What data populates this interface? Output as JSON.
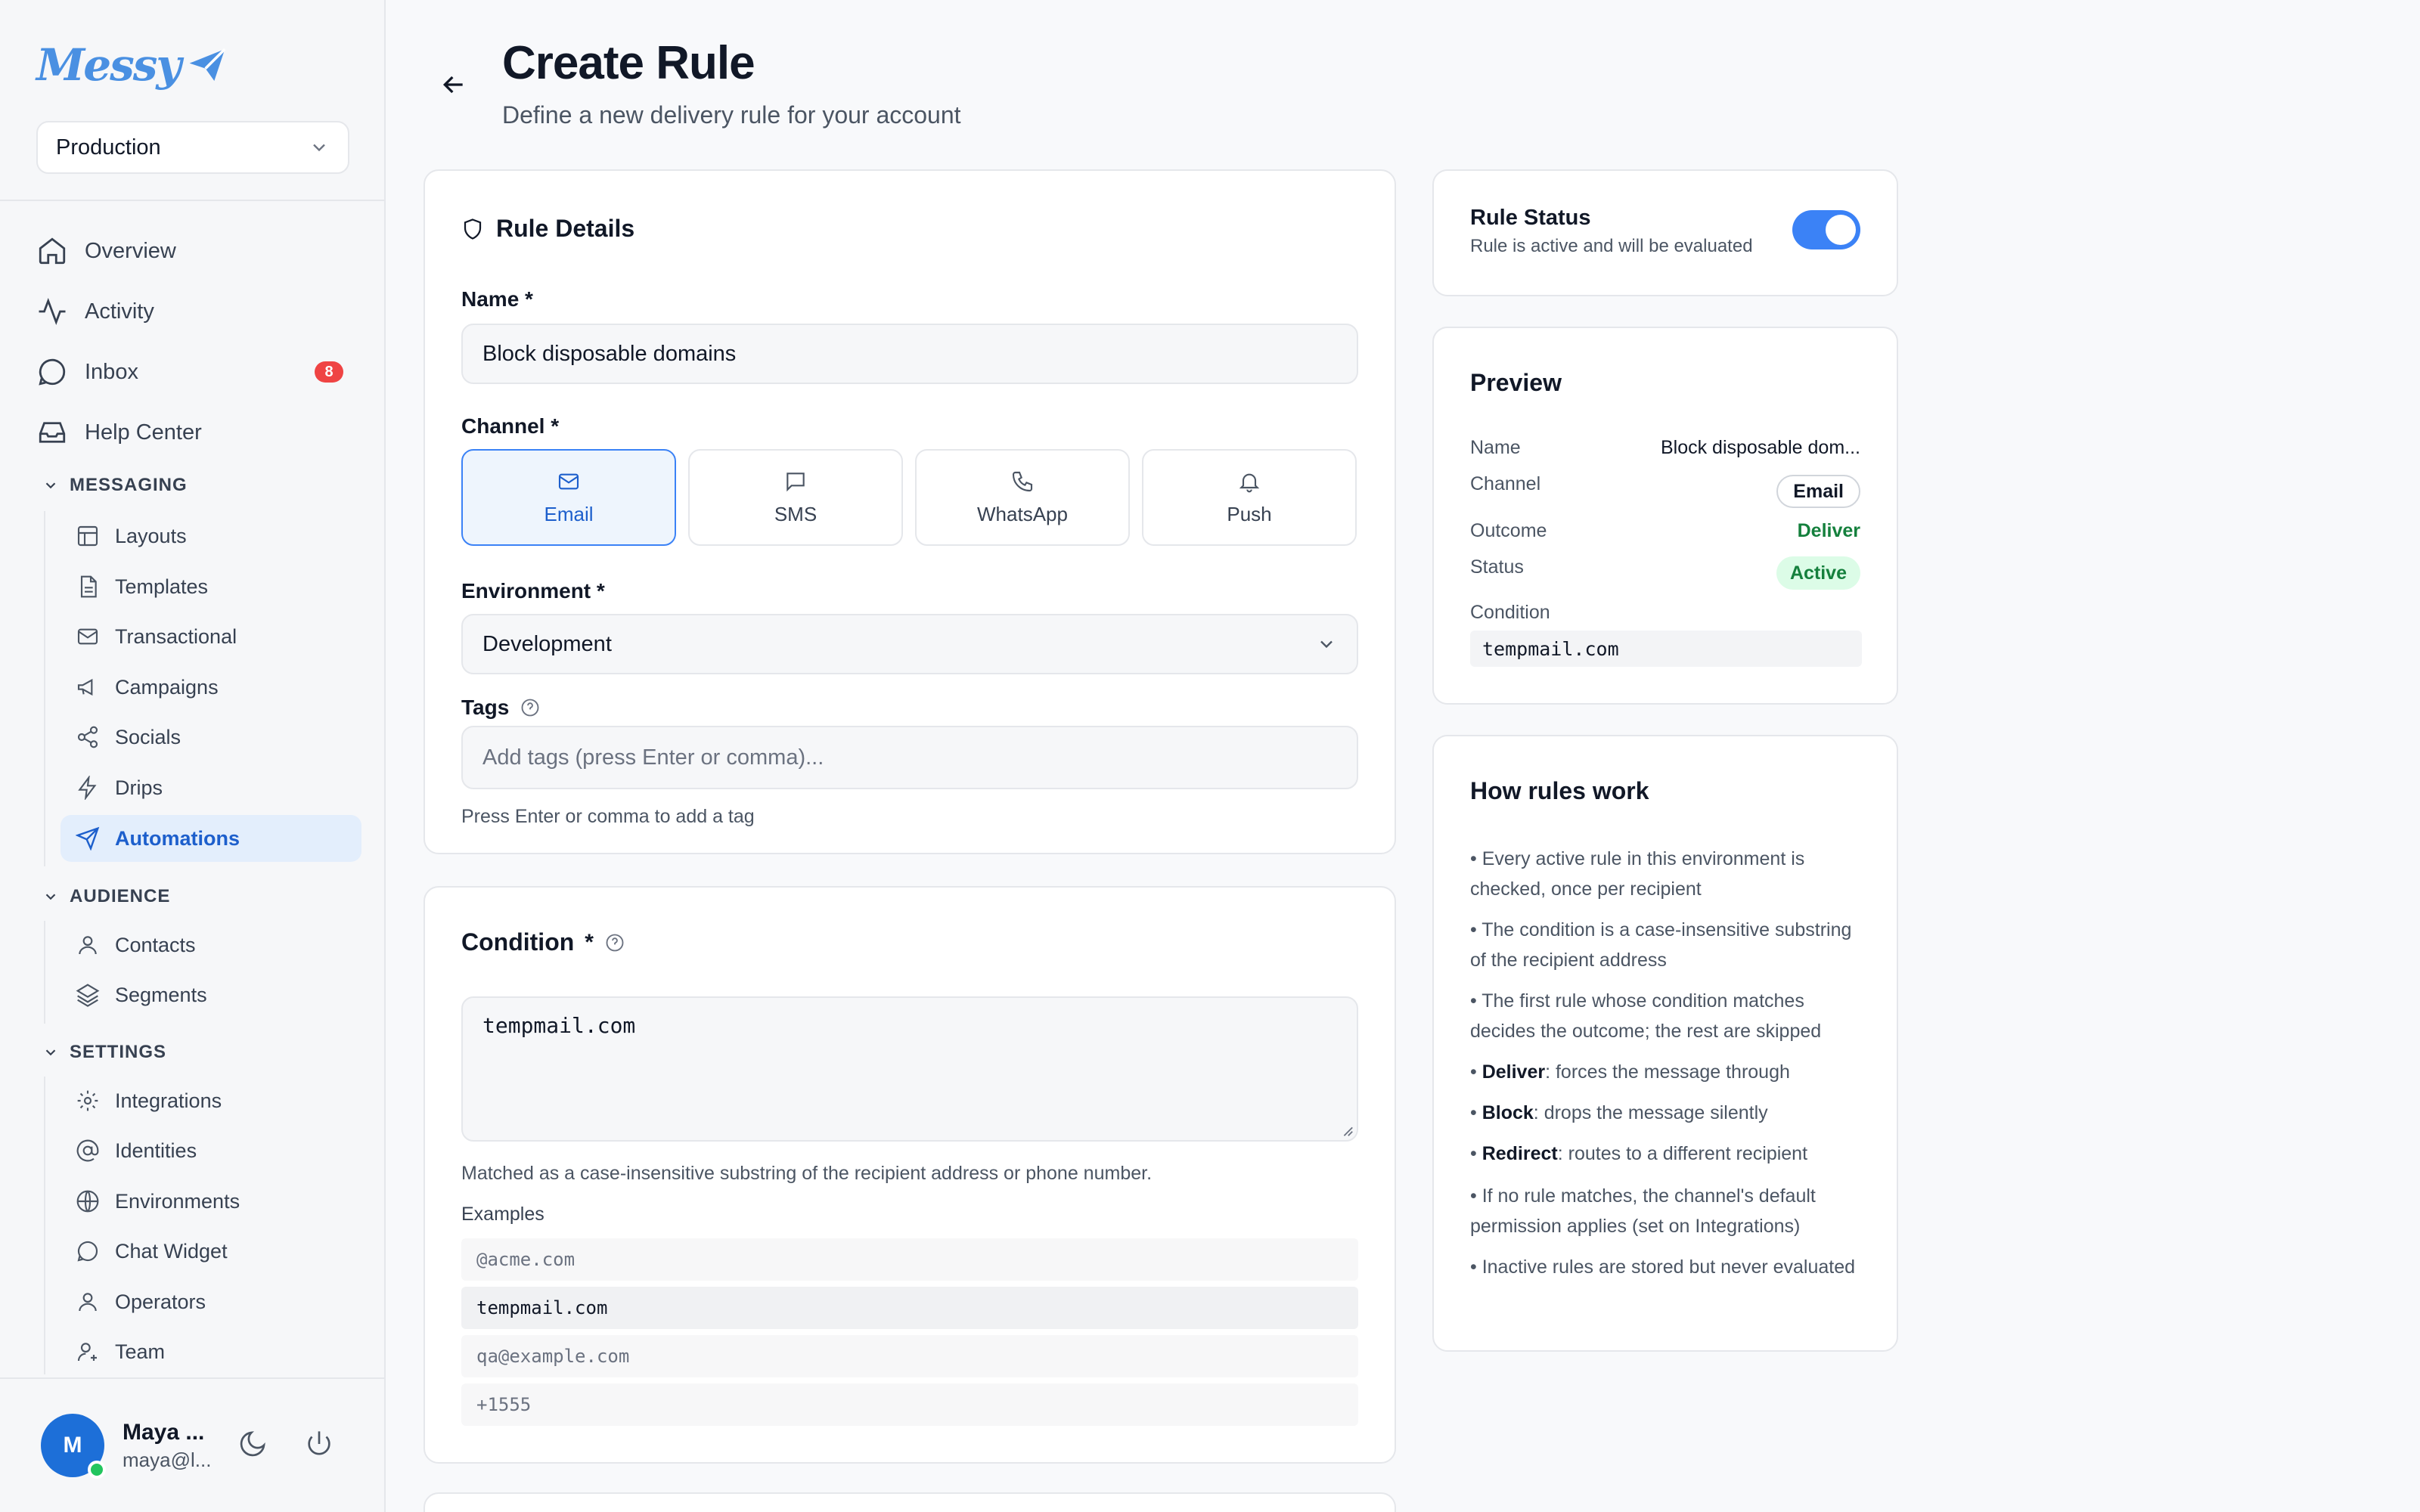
{
  "brand": {
    "name": "Messy",
    "accent": "#4a90e2"
  },
  "sidebar": {
    "environment": "Production",
    "nav": [
      {
        "label": "Overview",
        "icon": "home-icon"
      },
      {
        "label": "Activity",
        "icon": "activity-icon"
      },
      {
        "label": "Inbox",
        "icon": "chat-icon",
        "badge": "8"
      },
      {
        "label": "Help Center",
        "icon": "inbox-tray-icon"
      }
    ],
    "sections": {
      "messaging": {
        "title": "MESSAGING",
        "items": [
          "Layouts",
          "Templates",
          "Transactional",
          "Campaigns",
          "Socials",
          "Drips",
          "Automations"
        ]
      },
      "audience": {
        "title": "AUDIENCE",
        "items": [
          "Contacts",
          "Segments"
        ]
      },
      "settings": {
        "title": "SETTINGS",
        "items": [
          "Integrations",
          "Identities",
          "Environments",
          "Chat Widget",
          "Operators",
          "Team"
        ]
      }
    },
    "user": {
      "initial": "M",
      "name": "Maya ...",
      "email": "maya@l..."
    }
  },
  "header": {
    "title": "Create Rule",
    "subtitle": "Define a new delivery rule for your account"
  },
  "rule_details": {
    "title": "Rule Details",
    "name_label": "Name *",
    "name_value": "Block disposable domains",
    "channel_label": "Channel *",
    "channels": [
      "Email",
      "SMS",
      "WhatsApp",
      "Push"
    ],
    "selected_channel": "Email",
    "environment_label": "Environment *",
    "environment_value": "Development",
    "tags_label": "Tags",
    "tags_placeholder": "Add tags (press Enter or comma)...",
    "tags_help": "Press Enter or comma to add a tag"
  },
  "condition": {
    "title": "Condition",
    "required_mark": "*",
    "value": "tempmail.com",
    "help": "Matched as a case-insensitive substring of the recipient address or phone number.",
    "examples_label": "Examples",
    "examples": [
      "@acme.com",
      "tempmail.com",
      "qa@example.com",
      "+1555"
    ]
  },
  "rule_status": {
    "title": "Rule Status",
    "description": "Rule is active and will be evaluated",
    "enabled": true
  },
  "preview": {
    "title": "Preview",
    "name_label": "Name",
    "name_value": "Block disposable dom...",
    "channel_label": "Channel",
    "channel_value": "Email",
    "outcome_label": "Outcome",
    "outcome_value": "Deliver",
    "status_label": "Status",
    "status_value": "Active",
    "condition_label": "Condition",
    "condition_value": "tempmail.com"
  },
  "how_rules_work": {
    "title": "How rules work",
    "items": [
      {
        "bold": "",
        "text": "Every active rule in this environment is checked, once per recipient"
      },
      {
        "bold": "",
        "text": "The condition is a case-insensitive substring of the recipient address"
      },
      {
        "bold": "",
        "text": "The first rule whose condition matches decides the outcome; the rest are skipped"
      },
      {
        "bold": "Deliver",
        "text": ": forces the message through"
      },
      {
        "bold": "Block",
        "text": ": drops the message silently"
      },
      {
        "bold": "Redirect",
        "text": ": routes to a different recipient"
      },
      {
        "bold": "",
        "text": "If no rule matches, the channel's default permission applies (set on Integrations)"
      },
      {
        "bold": "",
        "text": "Inactive rules are stored but never evaluated"
      }
    ]
  },
  "colors": {
    "primary": "#3b82f6",
    "success": "#15803d",
    "badge": "#ef4444"
  }
}
